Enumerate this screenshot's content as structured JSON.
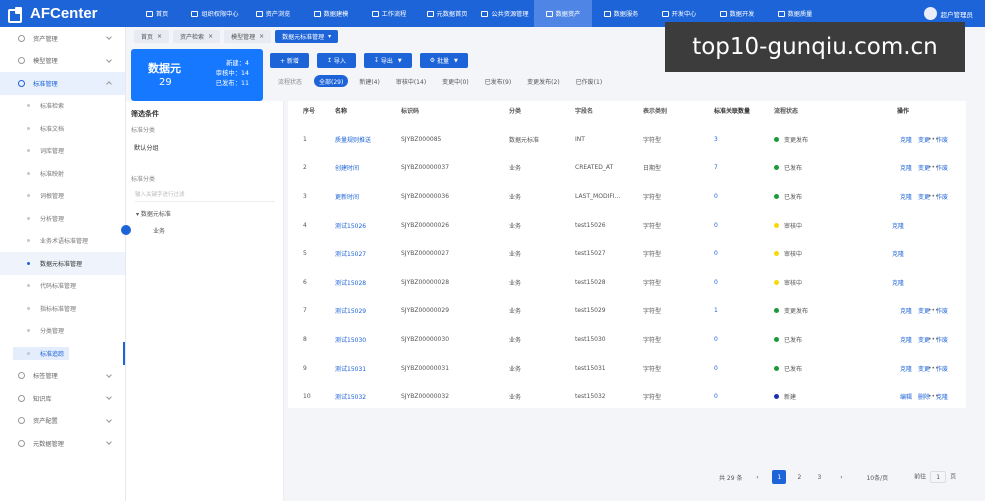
{
  "app": {
    "logo": "AFCenter"
  },
  "topnav": [
    {
      "label": "首页"
    },
    {
      "label": "组织权限中心"
    },
    {
      "label": "资产浏览"
    },
    {
      "label": "数据建模"
    },
    {
      "label": "工作流程"
    },
    {
      "label": "元数据首页"
    },
    {
      "label": "公共资源管理"
    },
    {
      "label": "数据资产"
    },
    {
      "label": "数据服务"
    },
    {
      "label": "开发中心"
    },
    {
      "label": "数据开发"
    },
    {
      "label": "数据质量"
    }
  ],
  "user": {
    "name": "超户管理员"
  },
  "sidebar": {
    "items": [
      {
        "label": "资产管理"
      },
      {
        "label": "模型管理"
      },
      {
        "label": "标准管理"
      }
    ],
    "subitems": [
      {
        "label": "标准检索"
      },
      {
        "label": "标准文档"
      },
      {
        "label": "词库管理"
      },
      {
        "label": "标准映射"
      },
      {
        "label": "词根管理"
      },
      {
        "label": "分析管理"
      },
      {
        "label": "业务术语标准管理"
      },
      {
        "label": "数据元标准管理"
      },
      {
        "label": "代码标准管理"
      },
      {
        "label": "指标标准管理"
      },
      {
        "label": "分类管理"
      },
      {
        "label": "标准追踪"
      }
    ],
    "bottom": [
      {
        "label": "标签管理"
      },
      {
        "label": "知识库"
      },
      {
        "label": "资产配置"
      },
      {
        "label": "元数据管理"
      }
    ]
  },
  "tabs": [
    {
      "label": "首页"
    },
    {
      "label": "资产检索"
    },
    {
      "label": "模型管理"
    },
    {
      "label": "数据元标准管理"
    }
  ],
  "summary": {
    "title": "数据元",
    "count": "29",
    "stat1": "新建：4",
    "stat2": "审核中：14",
    "stat3": "已发布：11"
  },
  "actions": {
    "new": "+ 新增",
    "import": "导入",
    "export": "导出",
    "batch": "批量",
    "right": "高级"
  },
  "status_filter": {
    "label": "流程状态",
    "chips": [
      "全部(29)",
      "新建(4)",
      "审核中(14)",
      "变更中(0)",
      "已发布(9)",
      "变更发布(2)",
      "已作废(1)"
    ]
  },
  "filter": {
    "title": "筛选条件",
    "standard_label": "标准分类",
    "selected": "默认分组",
    "category_label": "标准分类",
    "search_placeholder": "输入关键字进行过滤",
    "tree_root": "数据元标准",
    "tree_child": "业务"
  },
  "table": {
    "headers": [
      "序号",
      "名称",
      "标识码",
      "分类",
      "字段名",
      "表示类别",
      "标准关联数量",
      "流程状态",
      "操作"
    ],
    "rows": [
      {
        "idx": "1",
        "name": "质量规则推送",
        "code": "SJYBZ000085",
        "category": "数据元标准",
        "field": "INT",
        "type": "字符型",
        "count": "3",
        "status": "变更发布",
        "status_color": "#1a9b3a",
        "ops": [
          "克隆",
          "变更",
          "作废"
        ]
      },
      {
        "idx": "2",
        "name": "创建时间",
        "code": "SJYBZ00000037",
        "category": "业务",
        "field": "CREATED_AT",
        "type": "日期型",
        "count": "7",
        "status": "已发布",
        "status_color": "#1a9b3a",
        "ops": [
          "克隆",
          "变更",
          "作废"
        ]
      },
      {
        "idx": "3",
        "name": "更新时间",
        "code": "SJYBZ00000036",
        "category": "业务",
        "field": "LAST_MODIFI...",
        "type": "字符型",
        "count": "0",
        "status": "已发布",
        "status_color": "#1a9b3a",
        "ops": [
          "克隆",
          "变更",
          "作废"
        ]
      },
      {
        "idx": "4",
        "name": "测试15026",
        "code": "SJYBZ00000026",
        "category": "业务",
        "field": "test15026",
        "type": "字符型",
        "count": "0",
        "status": "审核中",
        "status_color": "#f5d90a",
        "ops": [
          "克隆"
        ]
      },
      {
        "idx": "5",
        "name": "测试15027",
        "code": "SJYBZ00000027",
        "category": "业务",
        "field": "test15027",
        "type": "字符型",
        "count": "0",
        "status": "审核中",
        "status_color": "#f5d90a",
        "ops": [
          "克隆"
        ]
      },
      {
        "idx": "6",
        "name": "测试15028",
        "code": "SJYBZ00000028",
        "category": "业务",
        "field": "test15028",
        "type": "字符型",
        "count": "0",
        "status": "审核中",
        "status_color": "#f5d90a",
        "ops": [
          "克隆"
        ]
      },
      {
        "idx": "7",
        "name": "测试15029",
        "code": "SJYBZ00000029",
        "category": "业务",
        "field": "test15029",
        "type": "字符型",
        "count": "1",
        "status": "变更发布",
        "status_color": "#1a9b3a",
        "ops": [
          "克隆",
          "变更",
          "作废"
        ]
      },
      {
        "idx": "8",
        "name": "测试15030",
        "code": "SJYBZ00000030",
        "category": "业务",
        "field": "test15030",
        "type": "字符型",
        "count": "0",
        "status": "已发布",
        "status_color": "#1a9b3a",
        "ops": [
          "克隆",
          "变更",
          "作废"
        ]
      },
      {
        "idx": "9",
        "name": "测试15031",
        "code": "SJYBZ00000031",
        "category": "业务",
        "field": "test15031",
        "type": "字符型",
        "count": "0",
        "status": "已发布",
        "status_color": "#1a9b3a",
        "ops": [
          "克隆",
          "变更",
          "作废"
        ]
      },
      {
        "idx": "10",
        "name": "测试15032",
        "code": "SJYBZ00000032",
        "category": "业务",
        "field": "test15032",
        "type": "字符型",
        "count": "0",
        "status": "新建",
        "status_color": "#1d2fb8",
        "ops": [
          "编辑",
          "删除",
          "克隆"
        ]
      }
    ]
  },
  "pagination": {
    "total": "共 29 条",
    "pages": [
      "1",
      "2",
      "3"
    ],
    "size": "10条/页",
    "jump_prefix": "前往",
    "jump_value": "1",
    "jump_suffix": "页"
  },
  "watermark": {
    "text": "top10-gunqiu.com.cn"
  }
}
